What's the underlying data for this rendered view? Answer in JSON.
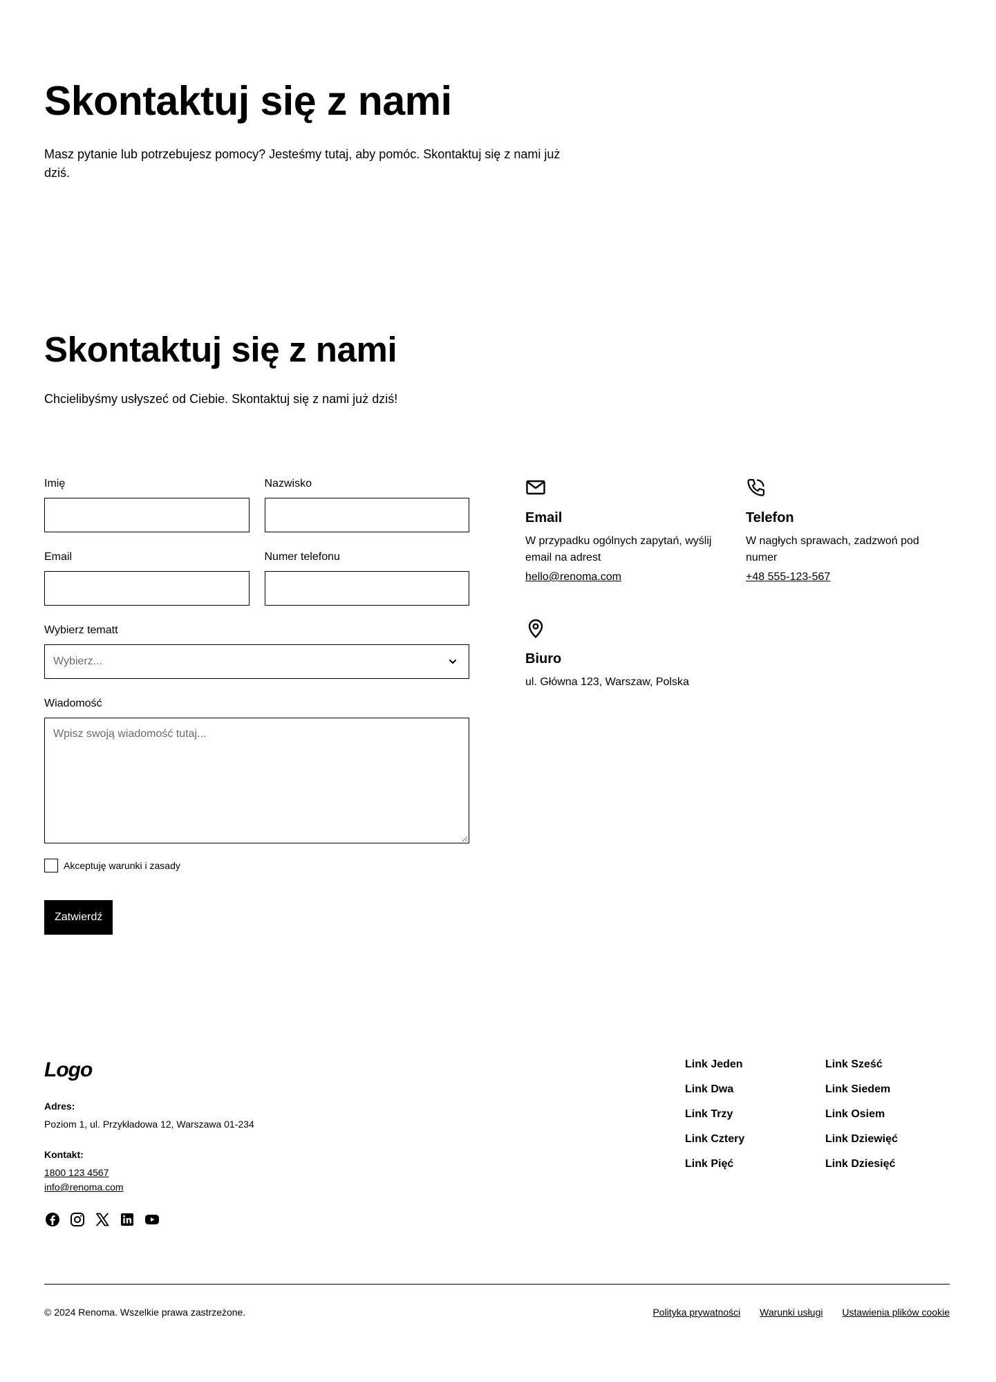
{
  "hero": {
    "title": "Skontaktuj się z nami",
    "text": "Masz pytanie lub potrzebujesz pomocy? Jesteśmy tutaj, aby pomóc. Skontaktuj się z nami już dziś."
  },
  "contact": {
    "title": "Skontaktuj się z nami",
    "text": "Chcielibyśmy usłyszeć od Ciebie. Skontaktuj się z nami już dziś!"
  },
  "form": {
    "first_name_label": "Imię",
    "last_name_label": "Nazwisko",
    "email_label": "Email",
    "phone_label": "Numer telefonu",
    "topic_label": "Wybierz tematt",
    "topic_placeholder": "Wybierz...",
    "message_label": "Wiadomość",
    "message_placeholder": "Wpisz swoją wiadomość tutaj...",
    "terms_label": "Akceptuję warunki i zasady",
    "submit_label": "Zatwierdź"
  },
  "info": {
    "email": {
      "icon": "mail-icon",
      "title": "Email",
      "text": "W przypadku ogólnych zapytań, wyślij email na adrest",
      "link": "hello@renoma.com"
    },
    "phone": {
      "icon": "phone-icon",
      "title": "Telefon",
      "text": "W nagłych sprawach, zadzwoń pod numer",
      "link": "+48 555-123-567"
    },
    "office": {
      "icon": "map-pin-icon",
      "title": "Biuro",
      "text": "ul. Główna 123, Warszaw, Polska"
    }
  },
  "footer": {
    "logo": "Logo",
    "address_label": "Adres:",
    "address": "Poziom 1, ul. Przykładowa 12, Warszawa 01-234",
    "contact_label": "Kontakt:",
    "phone": "1800 123 4567",
    "email": "info@renoma.com",
    "socials": [
      "facebook-icon",
      "instagram-icon",
      "x-icon",
      "linkedin-icon",
      "youtube-icon"
    ],
    "links_col1": [
      "Link Jeden",
      "Link Dwa",
      "Link Trzy",
      "Link Cztery",
      "Link Pięć"
    ],
    "links_col2": [
      "Link Sześć",
      "Link Siedem",
      "Link Osiem",
      "Link Dziewięć",
      "Link Dziesięć"
    ],
    "copyright": "© 2024 Renoma. Wszelkie prawa zastrzeżone.",
    "legal": [
      "Polityka prywatności",
      "Warunki usługi",
      "Ustawienia plików cookie"
    ]
  }
}
